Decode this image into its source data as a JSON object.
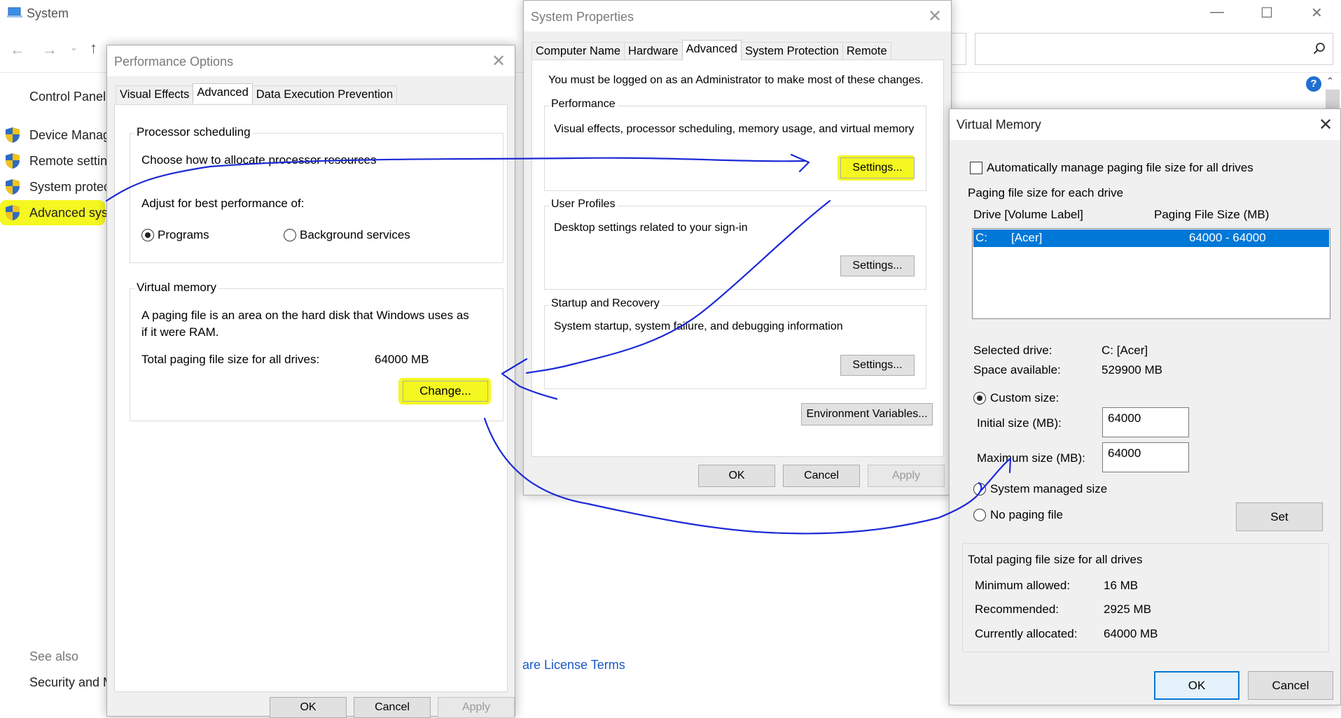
{
  "bg_window": {
    "title": "System",
    "controls": {
      "minimize": "—",
      "maximize": "☐",
      "close": "✕"
    },
    "nav": {
      "back": "←",
      "forward": "→",
      "up": "↑"
    },
    "control_panel_label": "Control Panel",
    "sidebar_items": [
      "Device Manag",
      "Remote settin",
      "System protec",
      "Advanced sys"
    ],
    "see_also": "See also",
    "security_item": "Security and M",
    "license_link": "are License Terms"
  },
  "performance_options": {
    "title": "Performance Options",
    "tabs": [
      "Visual Effects",
      "Advanced",
      "Data Execution Prevention"
    ],
    "processor": {
      "label": "Processor scheduling",
      "desc": "Choose how to allocate processor resources",
      "adjust": "Adjust for best performance of:",
      "opt_programs": "Programs",
      "opt_background": "Background services"
    },
    "virtual_memory": {
      "label": "Virtual memory",
      "desc_line1": "A paging file is an area on the hard disk that Windows uses as",
      "desc_line2": "if it were RAM.",
      "total_label": "Total paging file size for all drives:",
      "total_value": "64000 MB",
      "change_button": "Change..."
    },
    "footer_buttons": [
      "OK",
      "Cancel",
      "Apply"
    ]
  },
  "system_properties": {
    "title": "System Properties",
    "tabs": [
      "Computer Name",
      "Hardware",
      "Advanced",
      "System Protection",
      "Remote"
    ],
    "admin_note": "You must be logged on as an Administrator to make most of these changes.",
    "performance": {
      "label": "Performance",
      "desc": "Visual effects, processor scheduling, memory usage, and virtual memory",
      "button": "Settings..."
    },
    "user_profiles": {
      "label": "User Profiles",
      "desc": "Desktop settings related to your sign-in",
      "button": "Settings..."
    },
    "startup": {
      "label": "Startup and Recovery",
      "desc": "System startup, system failure, and debugging information",
      "button": "Settings..."
    },
    "env_button": "Environment Variables...",
    "ok": "OK",
    "cancel": "Cancel",
    "apply": "Apply"
  },
  "virtual_memory_dialog": {
    "title": "Virtual Memory",
    "auto_manage": "Automatically manage paging file size for all drives",
    "per_drive_label": "Paging file size for each drive",
    "col_drive": "Drive  [Volume Label]",
    "col_size": "Paging File Size (MB)",
    "drives": [
      {
        "drive": "C:",
        "label": "[Acer]",
        "size": "64000 - 64000"
      }
    ],
    "selected_drive_label": "Selected drive:",
    "selected_drive_value": "C:  [Acer]",
    "space_label": "Space available:",
    "space_value": "529900 MB",
    "custom_size": "Custom size:",
    "initial_label": "Initial size (MB):",
    "initial_value": "64000",
    "max_label": "Maximum size (MB):",
    "max_value": "64000",
    "system_managed": "System managed size",
    "no_paging": "No paging file",
    "set_button": "Set",
    "total_label": "Total paging file size for all drives",
    "min_label": "Minimum allowed:",
    "min_value": "16 MB",
    "rec_label": "Recommended:",
    "rec_value": "2925 MB",
    "cur_label": "Currently allocated:",
    "cur_value": "64000 MB",
    "ok": "OK",
    "cancel": "Cancel"
  },
  "colors": {
    "annotation_ink": "#1c2ad6",
    "highlight": "#f4f720",
    "selection": "#0078d7",
    "shield_blue": "#2f6bc4",
    "shield_yellow": "#f2c31a"
  }
}
